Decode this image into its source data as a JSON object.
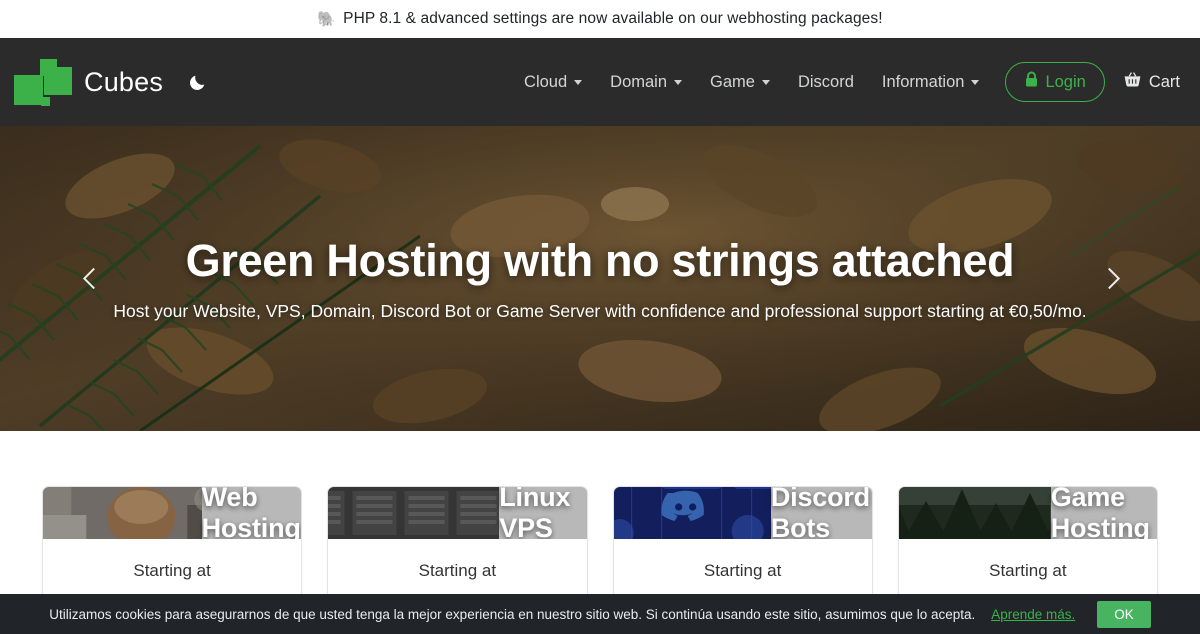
{
  "announcement": {
    "emoji": "🐘",
    "text": "PHP 8.1 & advanced settings are now available on our webhosting packages!"
  },
  "navbar": {
    "brand_name": "Cubes",
    "logo_color": "#3cb14a",
    "theme_toggle_icon": "moon-icon",
    "links": [
      {
        "label": "Cloud",
        "has_dropdown": true
      },
      {
        "label": "Domain",
        "has_dropdown": true
      },
      {
        "label": "Game",
        "has_dropdown": true
      },
      {
        "label": "Discord",
        "has_dropdown": false
      },
      {
        "label": "Information",
        "has_dropdown": true
      }
    ],
    "login": {
      "label": "Login",
      "icon": "lock-icon",
      "color": "#3cb14a"
    },
    "cart": {
      "label": "Cart",
      "icon": "shopping-basket-icon"
    }
  },
  "hero": {
    "title": "Green Hosting with no strings attached",
    "subtitle": "Host your Website, VPS, Domain, Discord Bot or Game Server with confidence and professional support starting at €0,50/mo.",
    "prev_icon": "chevron-left-icon",
    "next_icon": "chevron-right-icon"
  },
  "cards": [
    {
      "title": "Web Hosting",
      "starting_label": "Starting at",
      "banner_kind": "photo-cafe"
    },
    {
      "title": "Linux VPS",
      "starting_label": "Starting at",
      "banner_kind": "photo-servers"
    },
    {
      "title": "Discord Bots",
      "starting_label": "Starting at",
      "banner_kind": "discord-blue"
    },
    {
      "title": "Game Hosting",
      "starting_label": "Starting at",
      "banner_kind": "photo-forest"
    }
  ],
  "cookie_bar": {
    "text": "Utilizamos cookies para asegurarnos de que usted tenga la mejor experiencia en nuestro sitio web. Si continúa usando este sitio, asumimos que lo acepta.",
    "link_label": "Aprende más.",
    "ok_label": "OK",
    "accent": "#48b461"
  }
}
